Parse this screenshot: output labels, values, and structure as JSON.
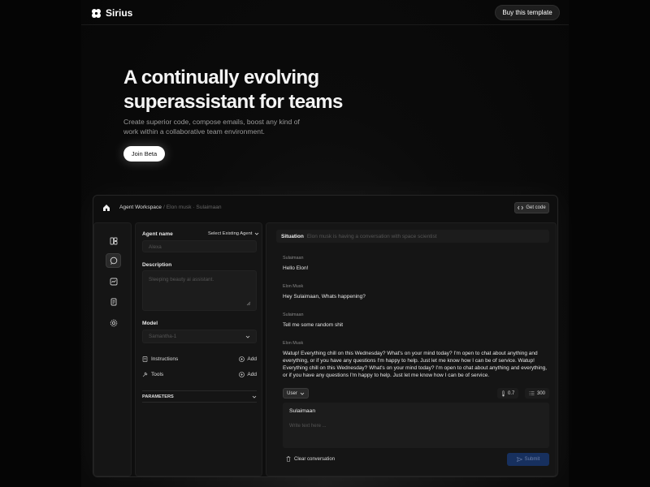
{
  "nav": {
    "brand": "Sirius",
    "cta_label": "Buy this template"
  },
  "hero": {
    "title_line1": "A continually evolving",
    "title_line2": "superassistant for teams",
    "subtitle": "Create superior code, compose emails, boost any kind of work within a collaborative team environment.",
    "join_label": "Join Beta"
  },
  "app": {
    "breadcrumb": {
      "root": "Agent Workspace",
      "separator": "/",
      "path": "Elon musk · Sulaimaan"
    },
    "get_code_label": "Get code",
    "rail_icons": [
      "layout-icon",
      "chat-icon",
      "chart-icon",
      "document-icon",
      "settings-icon"
    ],
    "agent": {
      "name_label": "Agent name",
      "select_existing": "Select Existing Agent",
      "name_placeholder": "Alexa",
      "description_label": "Description",
      "description_placeholder": "Sleeping beauty ai assistant.",
      "model_label": "Model",
      "model_value": "Samantha-1",
      "instructions_label": "Instructions",
      "tools_label": "Tools",
      "add_label": "Add",
      "parameters_label": "PARAMETERS"
    },
    "chat": {
      "situation_label": "Situation",
      "situation_text": "Elon musk is having a conversation with space scientist",
      "messages": [
        {
          "role": "Sulaimaan",
          "text": "Hello Elon!"
        },
        {
          "role": "Elon Musk",
          "text": "Hey Sulaimaan, Whats happening?"
        },
        {
          "role": "Sulaimaan",
          "text": "Tell me some random shit"
        },
        {
          "role": "Elon Musk",
          "text": "Watup!  Everything chill on this Wednesday? What's on your mind today? I'm open to chat about anything and everything, or if you have any questions I'm happy to help. Just let me know how I can be of service. Watup! Everything chill on this Wednesday? What's on your mind today? I'm open to chat about anything and everything, or if you have any questions I'm happy to help. Just let me know how I can be of service."
        }
      ],
      "role_select": "User",
      "temperature": "0.7",
      "max_tokens": "300",
      "compose_user": "Sulaimaan",
      "compose_placeholder": "Write text here ...",
      "clear_label": "Clear conversation",
      "submit_label": "Submit"
    }
  },
  "colors": {
    "background": "#050505",
    "panel": "#151515",
    "field": "#1c1c1c",
    "submit": "#17305e"
  }
}
